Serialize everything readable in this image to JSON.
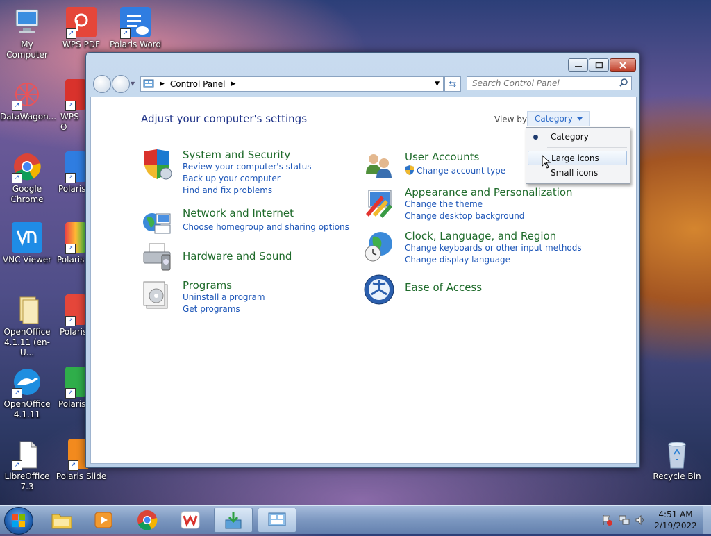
{
  "desktop": {
    "icons": [
      {
        "label": "My Computer"
      },
      {
        "label": "WPS PDF"
      },
      {
        "label": "Polaris Word"
      },
      {
        "label": "DataWagon..."
      },
      {
        "label": "WPS O"
      },
      {
        "label": "Google Chrome"
      },
      {
        "label": "Polaris"
      },
      {
        "label": "VNC Viewer"
      },
      {
        "label": "Polaris"
      },
      {
        "label": "OpenOffice 4.1.11 (en-U..."
      },
      {
        "label": "Polaris"
      },
      {
        "label": "OpenOffice 4.1.11"
      },
      {
        "label": "Polaris"
      },
      {
        "label": "LibreOffice 7.3"
      },
      {
        "label": "Polaris Slide"
      },
      {
        "label": "Recycle Bin"
      }
    ]
  },
  "window": {
    "address": {
      "root_icon": "control-panel-icon",
      "crumb": "Control Panel"
    },
    "search_placeholder": "Search Control Panel",
    "page_title": "Adjust your computer's settings",
    "view_by_label": "View by:",
    "view_by_value": "Category",
    "categories": [
      {
        "title": "System and Security",
        "icon": "shield-icon",
        "links": [
          "Review your computer's status",
          "Back up your computer",
          "Find and fix problems"
        ]
      },
      {
        "title": "Network and Internet",
        "icon": "network-icon",
        "links": [
          "Choose homegroup and sharing options"
        ]
      },
      {
        "title": "Hardware and Sound",
        "icon": "printer-icon",
        "links": []
      },
      {
        "title": "Programs",
        "icon": "programs-icon",
        "links": [
          "Uninstall a program",
          "Get programs"
        ]
      },
      {
        "title": "User Accounts",
        "icon": "users-icon",
        "links": [
          "Change account type"
        ]
      },
      {
        "title": "Appearance and Personalization",
        "icon": "appearance-icon",
        "links": [
          "Change the theme",
          "Change desktop background"
        ]
      },
      {
        "title": "Clock, Language, and Region",
        "icon": "globe-clock-icon",
        "links": [
          "Change keyboards or other input methods",
          "Change display language"
        ]
      },
      {
        "title": "Ease of Access",
        "icon": "ease-of-access-icon",
        "links": []
      }
    ]
  },
  "viewby_menu": {
    "items": [
      {
        "label": "Category",
        "selected": true
      },
      {
        "label": "Large icons",
        "selected": false
      },
      {
        "label": "Small icons",
        "selected": false
      }
    ]
  },
  "taskbar": {
    "time": "4:51 AM",
    "date": "2/19/2022"
  },
  "colors": {
    "category_title": "#1f6b2b",
    "link": "#1d56b8",
    "page_title": "#1e3287"
  }
}
